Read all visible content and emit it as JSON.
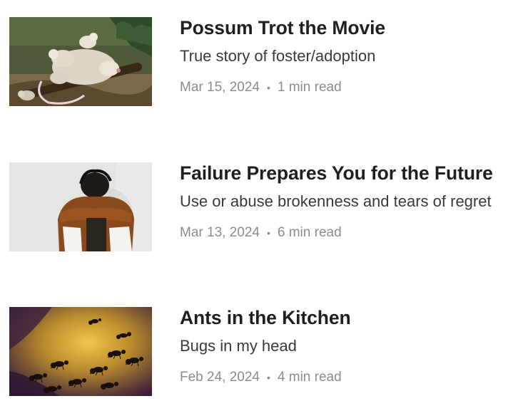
{
  "posts": [
    {
      "title": "Possum Trot the Movie",
      "subtitle": "True story of foster/adoption",
      "date": "Mar 15, 2024",
      "read_time": "1 min read"
    },
    {
      "title": "Failure Prepares You for the Future",
      "subtitle": "Use or abuse brokenness and tears of regret",
      "date": "Mar 13, 2024",
      "read_time": "6 min read"
    },
    {
      "title": "Ants in the Kitchen",
      "subtitle": "Bugs in my head",
      "date": "Feb 24, 2024",
      "read_time": "4 min read"
    }
  ],
  "separator": "•"
}
